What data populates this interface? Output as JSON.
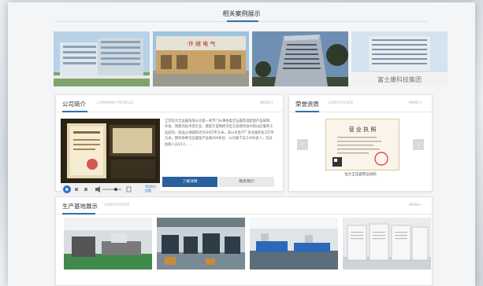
{
  "cases": {
    "title": "相关案例展示",
    "photos": [
      {
        "name": "case-photo-office-building"
      },
      {
        "name": "case-photo-company-gate",
        "sign": "·许 继 电 气"
      },
      {
        "name": "case-photo-tower-building"
      },
      {
        "name": "case-photo-fushikang-building",
        "sign": "富士康科技集团"
      }
    ]
  },
  "company": {
    "title": "公司简介",
    "subtitle": "COMPANY PROFILE",
    "more": "MORE+",
    "description": "江苏恒大全压器有限公司是一家专门从事各类全压器及其配套产品研制、开发、销售的技术型企业，建起于美陶经济区交会理所扶州阳山区服务工业园内，商品占地面积达5020万平方米，非以司生产厂房总面积近3万平方米，拥有各种全压器生产设备400余台，公司旗下员工400多人，其员加研人员15人，...",
    "primary_button": "了解详情",
    "secondary_button": "联系我们",
    "video_brand": "YOUKU 优酷"
  },
  "honor": {
    "title": "荣誉资质",
    "subtitle": "CERTIFICATE",
    "more": "MORE+",
    "license_heading": "营 业 执 照",
    "caption": "恒大全压器营业执照"
  },
  "production": {
    "title": "生产基地展示",
    "subtitle": "CERTIFICATE",
    "more": "MORE+"
  },
  "colors": {
    "accent": "#2f6fb3",
    "button": "#2a5f9e"
  }
}
